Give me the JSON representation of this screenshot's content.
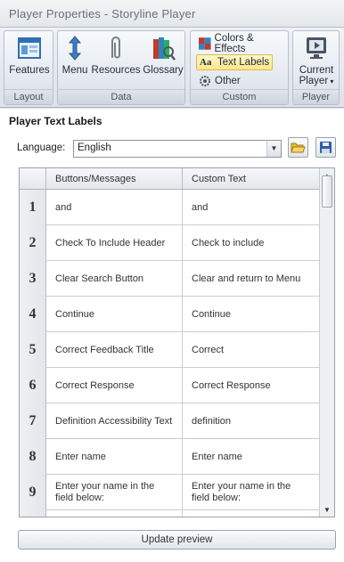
{
  "window": {
    "title": "Player Properties - Storyline Player"
  },
  "ribbon": {
    "groups": [
      {
        "label": "Layout",
        "buttons": [
          {
            "label": "Features",
            "icon": "features-icon"
          }
        ]
      },
      {
        "label": "Data",
        "buttons": [
          {
            "label": "Menu",
            "icon": "menu-icon"
          },
          {
            "label": "Resources",
            "icon": "paperclip-icon"
          },
          {
            "label": "Glossary",
            "icon": "glossary-books-icon"
          }
        ]
      },
      {
        "label": "Custom",
        "buttons": [
          {
            "label": "Colors & Effects",
            "icon": "colors-effects-icon"
          },
          {
            "label": "Text Labels",
            "icon": "text-labels-icon",
            "active": true
          },
          {
            "label": "Other",
            "icon": "gear-icon"
          }
        ]
      },
      {
        "label": "Player",
        "buttons": [
          {
            "label": "Current",
            "label2": "Player",
            "icon": "player-monitor-icon"
          }
        ]
      }
    ]
  },
  "panel": {
    "title": "Player Text Labels",
    "language_label": "Language:",
    "language_value": "English",
    "columns": [
      "Buttons/Messages",
      "Custom Text"
    ],
    "rows": [
      {
        "num": "1",
        "message": "and",
        "custom": "and"
      },
      {
        "num": "2",
        "message": "Check To Include Header",
        "custom": "Check to include"
      },
      {
        "num": "3",
        "message": "Clear Search Button",
        "custom": "Clear and return to Menu"
      },
      {
        "num": "4",
        "message": "Continue",
        "custom": "Continue"
      },
      {
        "num": "5",
        "message": "Correct Feedback Title",
        "custom": "Correct"
      },
      {
        "num": "6",
        "message": "Correct Response",
        "custom": "Correct Response"
      },
      {
        "num": "7",
        "message": "Definition Accessibility Text",
        "custom": "definition"
      },
      {
        "num": "8",
        "message": "Enter name",
        "custom": "Enter name"
      },
      {
        "num": "9",
        "message": "Enter your name in the field below:",
        "custom": "Enter your name in the field below:"
      },
      {
        "num": "",
        "message": "",
        "custom": ""
      }
    ],
    "update_button": "Update preview"
  },
  "colors": {
    "accent_active": "#ffe58a",
    "ribbon_bg": "#dde2e9",
    "panel_bg": "#ffffff"
  }
}
